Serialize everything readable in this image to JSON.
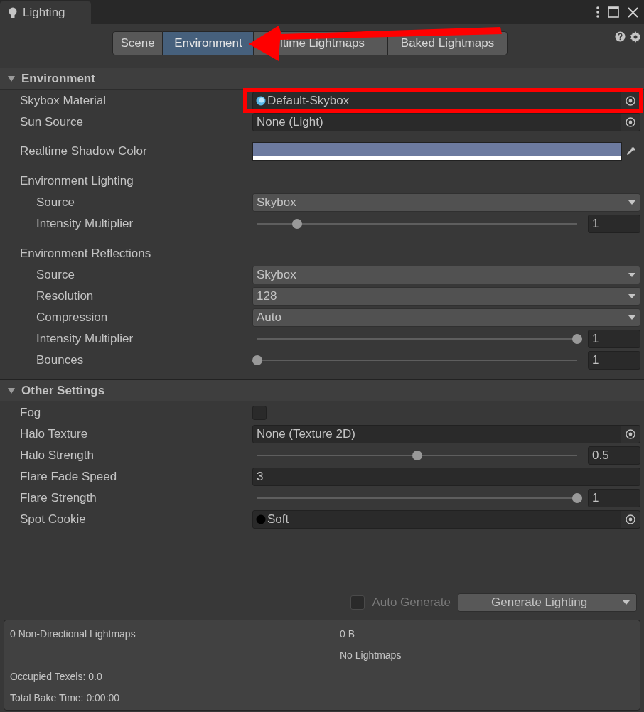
{
  "window": {
    "tab": "Lighting"
  },
  "toolbar_tabs": [
    {
      "label": "Scene",
      "selected": false
    },
    {
      "label": "Environment",
      "selected": true
    },
    {
      "label": "ltime Lightmaps",
      "selected": false
    },
    {
      "label": "Baked Lightmaps",
      "selected": false
    }
  ],
  "sections": [
    {
      "title": "Environment",
      "expanded": true,
      "rows": [
        {
          "kind": "object",
          "label": "Skybox Material",
          "value": "Default-Skybox",
          "thumbnail": {
            "kind": "sphere"
          },
          "highlighted": true
        },
        {
          "kind": "object",
          "label": "Sun Source",
          "value": "None (Light)",
          "highlighted": false
        },
        {
          "kind": "color",
          "label": "Realtime Shadow Color",
          "color": "#6d7ba0"
        },
        {
          "kind": "group",
          "label": "Environment Lighting",
          "children": [
            {
              "kind": "dropdown",
              "label": "Source",
              "value": "Skybox"
            },
            {
              "kind": "slider",
              "label": "Intensity Multiplier",
              "level": 0.125,
              "reading": "1"
            }
          ]
        },
        {
          "kind": "group",
          "label": "Environment Reflections",
          "children": [
            {
              "kind": "dropdown",
              "label": "Source",
              "value": "Skybox"
            },
            {
              "kind": "dropdown",
              "label": "Resolution",
              "value": "128"
            },
            {
              "kind": "dropdown",
              "label": "Compression",
              "value": "Auto"
            },
            {
              "kind": "slider",
              "label": "Intensity Multiplier",
              "level": 1,
              "reading": "1"
            },
            {
              "kind": "slider",
              "label": "Bounces",
              "level": 0,
              "reading": "1"
            }
          ]
        }
      ]
    },
    {
      "title": "Other Settings",
      "expanded": true,
      "rows": [
        {
          "kind": "checkbox",
          "label": "Fog",
          "checked": false
        },
        {
          "kind": "object",
          "label": "Halo Texture",
          "value": "None (Texture 2D)",
          "highlighted": false
        },
        {
          "kind": "slider",
          "label": "Halo Strength",
          "level": 0.5,
          "reading": "0.5"
        },
        {
          "kind": "number",
          "label": "Flare Fade Speed",
          "value": "3"
        },
        {
          "kind": "slider",
          "label": "Flare Strength",
          "level": 1,
          "reading": "1"
        },
        {
          "kind": "object",
          "label": "Spot Cookie",
          "value": "Soft",
          "thumbnail": {
            "kind": "dot"
          },
          "highlighted": false
        }
      ]
    }
  ],
  "auto_generate": {
    "label": "Auto Generate",
    "checked": false,
    "disabled": true
  },
  "generate_button": "Generate Lighting",
  "stats": [
    {
      "left": "0 Non-Directional Lightmaps",
      "right": "0 B"
    },
    {
      "right": "No Lightmaps"
    },
    {
      "left": "Occupied Texels: 0.0"
    },
    {
      "left": "Total Bake Time: 0:00:00"
    }
  ],
  "annotations": [
    {
      "kind": "arrow"
    }
  ]
}
